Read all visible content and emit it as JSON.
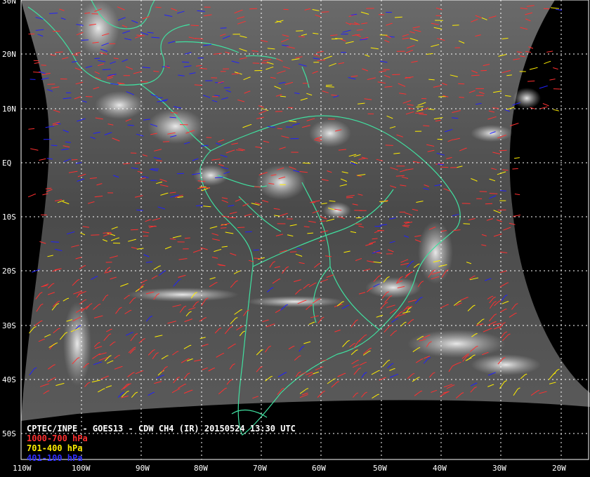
{
  "title": "CPTEC/INPE - GOES13 - CDW CH4 (IR) 20150524 13:30 UTC",
  "legend": [
    {
      "label": "1000-700 hPa",
      "color": "#ff3030"
    },
    {
      "label": "701-400 hPa",
      "color": "#ffee00"
    },
    {
      "label": "401-100 hPa",
      "color": "#2020ff"
    }
  ],
  "colors": {
    "coastline": "#40e0a0",
    "grid": "#ffffff",
    "background": "#000000"
  },
  "lat_labels": [
    "30N",
    "20N",
    "10N",
    "EQ",
    "10S",
    "20S",
    "30S",
    "40S",
    "50S"
  ],
  "lon_labels": [
    "110W",
    "100W",
    "90W",
    "80W",
    "70W",
    "60W",
    "50W",
    "40W",
    "30W",
    "20W"
  ]
}
